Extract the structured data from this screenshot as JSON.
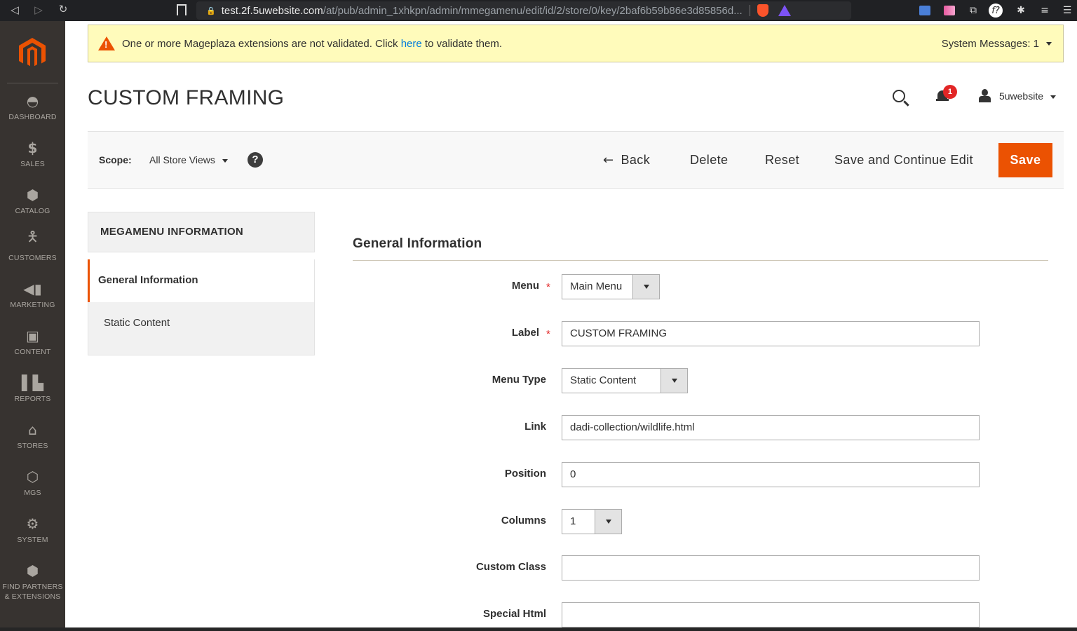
{
  "browser": {
    "url_host": "test.2f.5uwebsite.com",
    "url_path": "/at/pub/admin_1xhkpn/admin/mmegamenu/edit/id/2/store/0/key/2baf6b59b86e3d85856d..."
  },
  "sidebar": {
    "items": [
      {
        "label": "DASHBOARD",
        "icon": "dashboard-icon"
      },
      {
        "label": "SALES",
        "icon": "dollar-icon"
      },
      {
        "label": "CATALOG",
        "icon": "box-icon"
      },
      {
        "label": "CUSTOMERS",
        "icon": "person-icon"
      },
      {
        "label": "MARKETING",
        "icon": "megaphone-icon"
      },
      {
        "label": "CONTENT",
        "icon": "layout-icon"
      },
      {
        "label": "REPORTS",
        "icon": "bar-chart-icon"
      },
      {
        "label": "STORES",
        "icon": "store-icon"
      },
      {
        "label": "MGS",
        "icon": "hexagon-icon"
      },
      {
        "label": "SYSTEM",
        "icon": "gear-icon"
      },
      {
        "label": "FIND PARTNERS",
        "label2": "& EXTENSIONS",
        "icon": "boxes-icon"
      }
    ]
  },
  "system_message": {
    "text_before": "One or more Mageplaza extensions are not validated. Click",
    "link": "here",
    "text_after": "to validate them.",
    "right": "System Messages: 1"
  },
  "header": {
    "title": "CUSTOM FRAMING",
    "notification_count": "1",
    "user": "5uwebsite"
  },
  "toolbar": {
    "scope_label": "Scope:",
    "scope_value": "All Store Views",
    "help": "?",
    "back": "Back",
    "delete": "Delete",
    "reset": "Reset",
    "save_continue": "Save and Continue Edit",
    "save": "Save"
  },
  "tabs": {
    "title": "MEGAMENU INFORMATION",
    "items": [
      "General Information",
      "Static Content"
    ]
  },
  "form": {
    "section_title": "General Information",
    "menu": {
      "label": "Menu",
      "value": "Main Menu",
      "required": "*"
    },
    "label": {
      "label": "Label",
      "value": "CUSTOM FRAMING",
      "required": "*"
    },
    "menu_type": {
      "label": "Menu Type",
      "value": "Static Content"
    },
    "link": {
      "label": "Link",
      "value": "dadi-collection/wildlife.html"
    },
    "position": {
      "label": "Position",
      "value": "0"
    },
    "columns": {
      "label": "Columns",
      "value": "1"
    },
    "custom_class": {
      "label": "Custom Class",
      "value": ""
    },
    "special_html": {
      "label": "Special Html",
      "value": ""
    }
  },
  "colors": {
    "accent": "#eb5202",
    "sidebar_bg": "#373330",
    "message_bg": "#fffbbb",
    "link": "#007bdb"
  }
}
